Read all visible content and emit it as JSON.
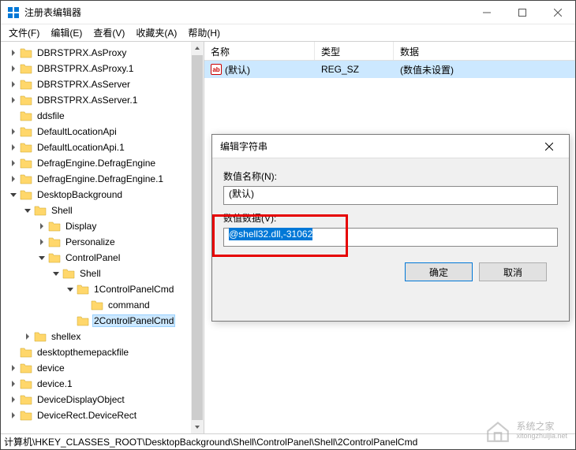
{
  "window": {
    "title": "注册表编辑器",
    "minimize": "—",
    "close": "✕"
  },
  "menu": {
    "file": "文件(F)",
    "edit": "编辑(E)",
    "view": "查看(V)",
    "favorites": "收藏夹(A)",
    "help": "帮助(H)"
  },
  "tree": [
    {
      "level": 0,
      "exp": "closed",
      "label": "DBRSTPRX.AsProxy"
    },
    {
      "level": 0,
      "exp": "closed",
      "label": "DBRSTPRX.AsProxy.1"
    },
    {
      "level": 0,
      "exp": "closed",
      "label": "DBRSTPRX.AsServer"
    },
    {
      "level": 0,
      "exp": "closed",
      "label": "DBRSTPRX.AsServer.1"
    },
    {
      "level": 0,
      "exp": "none",
      "label": "ddsfile"
    },
    {
      "level": 0,
      "exp": "closed",
      "label": "DefaultLocationApi"
    },
    {
      "level": 0,
      "exp": "closed",
      "label": "DefaultLocationApi.1"
    },
    {
      "level": 0,
      "exp": "closed",
      "label": "DefragEngine.DefragEngine"
    },
    {
      "level": 0,
      "exp": "closed",
      "label": "DefragEngine.DefragEngine.1"
    },
    {
      "level": 0,
      "exp": "open",
      "label": "DesktopBackground"
    },
    {
      "level": 1,
      "exp": "open",
      "label": "Shell"
    },
    {
      "level": 2,
      "exp": "closed",
      "label": "Display"
    },
    {
      "level": 2,
      "exp": "closed",
      "label": "Personalize"
    },
    {
      "level": 2,
      "exp": "open",
      "label": "ControlPanel"
    },
    {
      "level": 3,
      "exp": "open",
      "label": "Shell"
    },
    {
      "level": 4,
      "exp": "open",
      "label": "1ControlPanelCmd"
    },
    {
      "level": 5,
      "exp": "none",
      "label": "command"
    },
    {
      "level": 4,
      "exp": "none",
      "label": "2ControlPanelCmd",
      "sel": true
    },
    {
      "level": 1,
      "exp": "closed",
      "label": "shellex"
    },
    {
      "level": 0,
      "exp": "none",
      "label": "desktopthemepackfile"
    },
    {
      "level": 0,
      "exp": "closed",
      "label": "device"
    },
    {
      "level": 0,
      "exp": "closed",
      "label": "device.1"
    },
    {
      "level": 0,
      "exp": "closed",
      "label": "DeviceDisplayObject"
    },
    {
      "level": 0,
      "exp": "closed",
      "label": "DeviceRect.DeviceRect"
    }
  ],
  "list": {
    "cols": {
      "name": "名称",
      "type": "类型",
      "data": "数据"
    },
    "rows": [
      {
        "name": "(默认)",
        "type": "REG_SZ",
        "data": "(数值未设置)",
        "sel": true
      }
    ]
  },
  "dialog": {
    "title": "编辑字符串",
    "name_label": "数值名称(N):",
    "name_value": "(默认)",
    "data_label": "数值数据(V):",
    "data_value": "@shell32.dll,-31062",
    "ok": "确定",
    "cancel": "取消"
  },
  "statusbar": "计算机\\HKEY_CLASSES_ROOT\\DesktopBackground\\Shell\\ControlPanel\\Shell\\2ControlPanelCmd",
  "watermark": {
    "line1": "系统之家",
    "line2": "xitongzhuijia.net"
  }
}
